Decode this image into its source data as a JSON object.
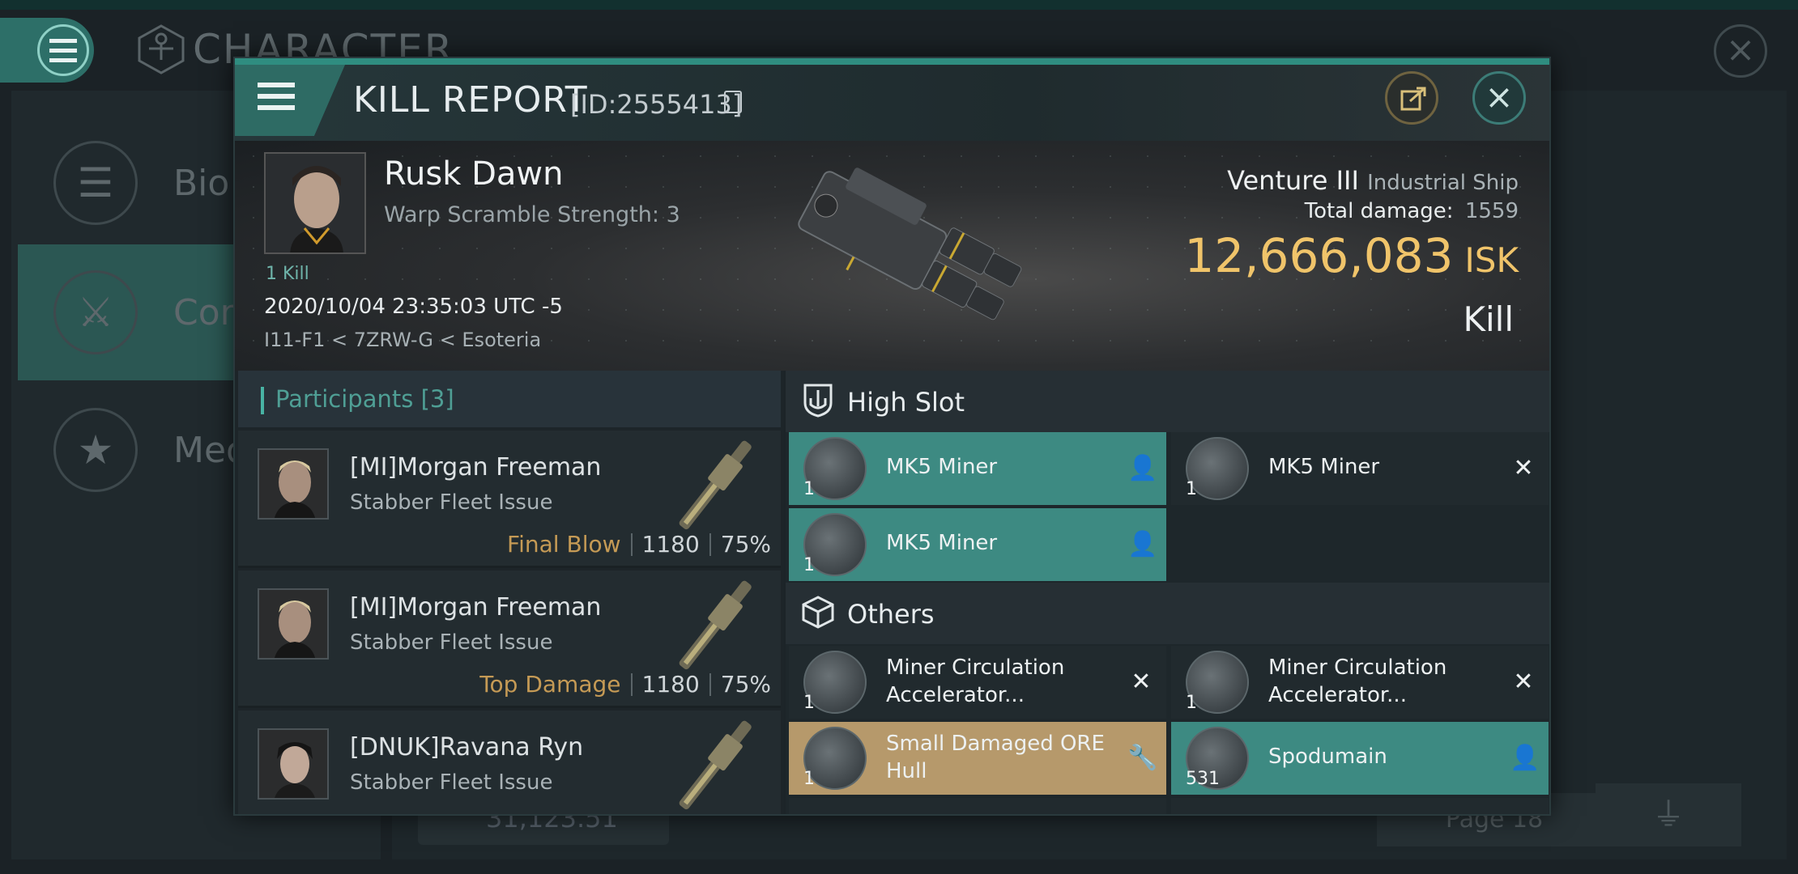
{
  "background": {
    "screen_title": "CHARACTER",
    "sidebar": [
      {
        "label": "Bio"
      },
      {
        "label": "Comb"
      },
      {
        "label": "Meda"
      }
    ],
    "bottom_amount": "31,123.51",
    "pager": "Page 18"
  },
  "kill_report": {
    "title": "KILL REPORT",
    "id": "[ID:2555413]",
    "victim": {
      "name": "Rusk Dawn",
      "warp_scramble": "Warp Scramble Strength: 3",
      "kills": "1 Kill",
      "datetime": "2020/10/04 23:35:03 UTC -5",
      "location": "I11-F1 < 7ZRW-G < Esoteria"
    },
    "ship": {
      "name": "Venture III",
      "class": "Industrial Ship",
      "total_damage_label": "Total damage:",
      "total_damage": "1559",
      "isk_value": "12,666,083",
      "isk_unit": "ISK",
      "result": "Kill"
    },
    "participants": {
      "header": "Participants [3]",
      "rows": [
        {
          "name": "[MI]Morgan Freeman",
          "ship": "Stabber Fleet Issue",
          "tag": "Final Blow",
          "damage": "1180",
          "percent": "75%"
        },
        {
          "name": "[MI]Morgan Freeman",
          "ship": "Stabber Fleet Issue",
          "tag": "Top Damage",
          "damage": "1180",
          "percent": "75%"
        },
        {
          "name": "[DNUK]Ravana Ryn",
          "ship": "Stabber Fleet Issue",
          "tag": "",
          "damage": "",
          "percent": ""
        }
      ]
    },
    "high_slot": {
      "header": "High Slot",
      "items": [
        {
          "name": "MK5 Miner",
          "qty": "1",
          "state": "dropped"
        },
        {
          "name": "MK5 Miner",
          "qty": "1",
          "state": "destroyed"
        },
        {
          "name": "MK5 Miner",
          "qty": "1",
          "state": "dropped"
        }
      ]
    },
    "others": {
      "header": "Others",
      "items": [
        {
          "name": "Miner Circulation Accelerator...",
          "qty": "1",
          "state": "destroyed"
        },
        {
          "name": "Miner Circulation Accelerator...",
          "qty": "1",
          "state": "destroyed"
        },
        {
          "name": "Small Damaged ORE Hull",
          "qty": "1",
          "state": "salvage"
        },
        {
          "name": "Spodumain",
          "qty": "531",
          "state": "dropped"
        }
      ]
    },
    "colors": {
      "accent_teal": "#3d8a82",
      "isk_gold": "#f0c46a",
      "salvage_gold": "#b6996b"
    }
  }
}
